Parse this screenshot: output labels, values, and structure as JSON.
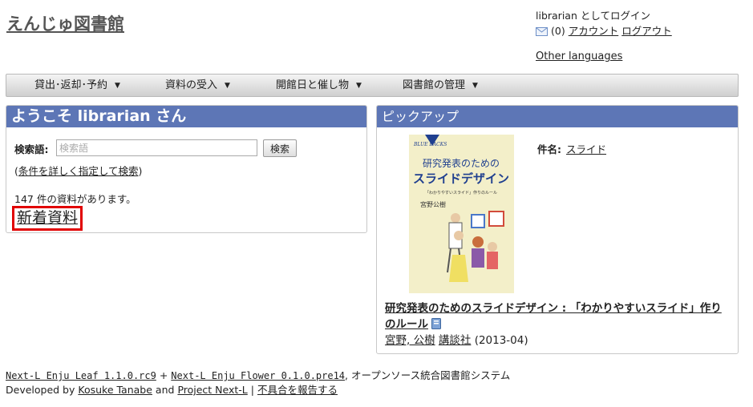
{
  "header": {
    "site_title": "えんじゅ図書館",
    "login_text": "librarian としてログイン",
    "mail_count": "(0)",
    "account_link": "アカウント",
    "logout_link": "ログアウト",
    "other_languages": "Other languages"
  },
  "nav": {
    "items": [
      {
        "label": "貸出･返却･予約"
      },
      {
        "label": "資料の受入"
      },
      {
        "label": "開館日と催し物"
      },
      {
        "label": "図書館の管理"
      }
    ]
  },
  "welcome_panel": {
    "heading": "ようこそ librarian さん",
    "search_label": "検索語:",
    "search_placeholder": "検索語",
    "search_value": "",
    "search_button": "検索",
    "advanced_open": "(",
    "advanced_link": "条件を詳しく指定して検索",
    "advanced_close": ")",
    "count_text": "147 件の資料があります。",
    "new_items_link": "新着資料"
  },
  "pickup_panel": {
    "heading": "ピックアップ",
    "subject_label": "件名:",
    "subject_value": "スライド",
    "book_title": "研究発表のためのスライドデザイン : 「わかりやすいスライド」作りのルール",
    "author": "宮野, 公樹",
    "publisher": "講談社",
    "date": "(2013-04)",
    "cover": {
      "series": "BLUE BACKS",
      "title_line1": "研究発表のための",
      "title_line2": "スライドデザイン",
      "subtitle": "「わかりやすいスライド」作りのルール",
      "author": "宮野公樹"
    }
  },
  "footer": {
    "leaf_link": "Next-L Enju Leaf 1.1.0.rc9",
    "plus": "+",
    "flower_link": "Next-L Enju Flower 0.1.0.pre14",
    "system_text": ", オープンソース統合図書館システム",
    "developed_by": "Developed by",
    "author_link": "Kosuke Tanabe",
    "and_text": "and",
    "project_link": "Project Next-L",
    "separator": "|",
    "report_link": "不具合を報告する"
  },
  "colors": {
    "panel_header": "#5d76b6",
    "highlight_border": "#e10000",
    "cover_background": "#f3efc9",
    "cover_accent": "#1f3f8f"
  }
}
